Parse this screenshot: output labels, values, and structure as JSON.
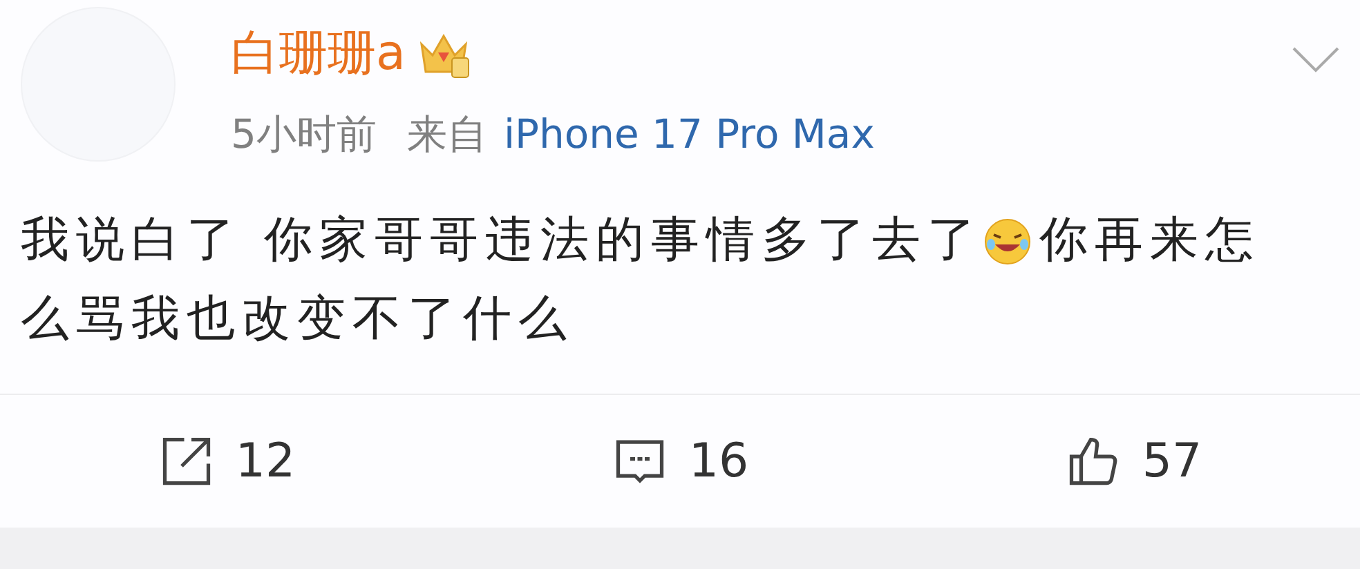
{
  "post": {
    "author": "白珊珊a",
    "time": "5小时前",
    "source_label": "来自",
    "source": "iPhone 17 Pro Max",
    "lines": [
      [
        {
          "kind": "text",
          "text": "我说白了 你家哥哥违法的事情多了去了"
        },
        {
          "kind": "emoji"
        },
        {
          "kind": "text",
          "text": "你再来怎"
        }
      ],
      [
        {
          "kind": "text",
          "text": "么骂我也改变不了什么"
        }
      ]
    ]
  },
  "actions": [
    {
      "kind": "share",
      "count": "12"
    },
    {
      "kind": "comment",
      "count": "16"
    },
    {
      "kind": "like",
      "count": "57"
    }
  ]
}
